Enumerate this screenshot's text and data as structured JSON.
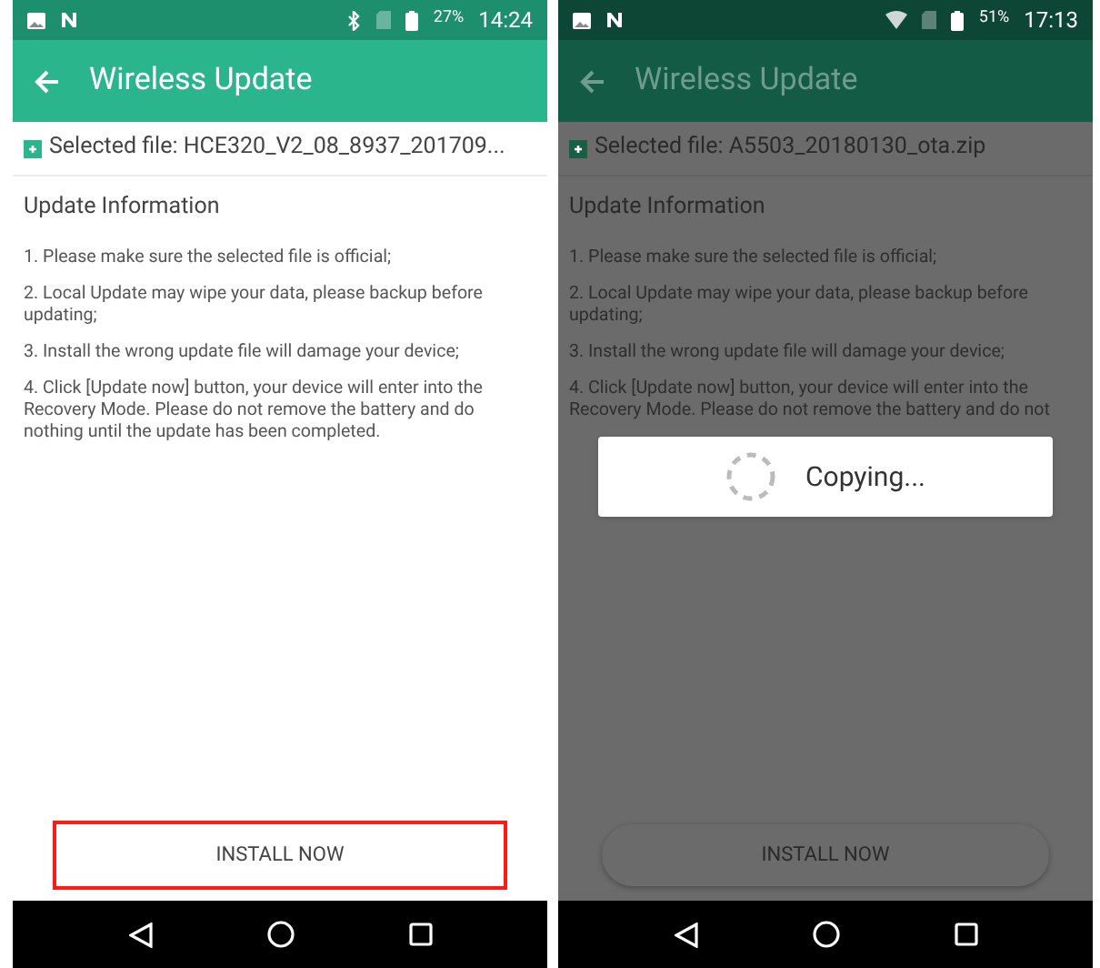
{
  "phones": [
    {
      "dimmed": false,
      "status_bar": {
        "icons": [
          {
            "kind": "bluetooth"
          }
        ],
        "battery": "27%",
        "time": "14:24"
      },
      "title": "Wireless Update",
      "selected_file": "Selected file: HCE320_V2_08_8937_201709...",
      "section_heading": "Update Information",
      "items": [
        "1. Please make sure the selected file is official;",
        "2. Local Update may wipe your data, please backup before updating;",
        "3. Install the wrong update file will damage your device;",
        "4. Click [Update now] button, your device will enter into the Recovery Mode. Please do not remove the battery and do nothing until the update has been completed."
      ],
      "install_button": {
        "label": "INSTALL NOW",
        "highlighted": true
      }
    },
    {
      "dimmed": true,
      "status_bar": {
        "icons": [
          {
            "kind": "wifi"
          }
        ],
        "battery": "51%",
        "time": "17:13"
      },
      "title": "Wireless Update",
      "selected_file": "Selected file: A5503_20180130_ota.zip",
      "section_heading": "Update Information",
      "items": [
        "1. Please make sure the selected file is official;",
        "2. Local Update may wipe your data, please backup before updating;",
        "3. Install the wrong update file will damage your device;",
        "4. Click [Update now] button, your device will enter into the Recovery Mode. Please do not remove the battery and do not"
      ],
      "dialog": {
        "text": "Copying..."
      },
      "install_button": {
        "label": "INSTALL NOW",
        "highlighted": false
      }
    }
  ]
}
